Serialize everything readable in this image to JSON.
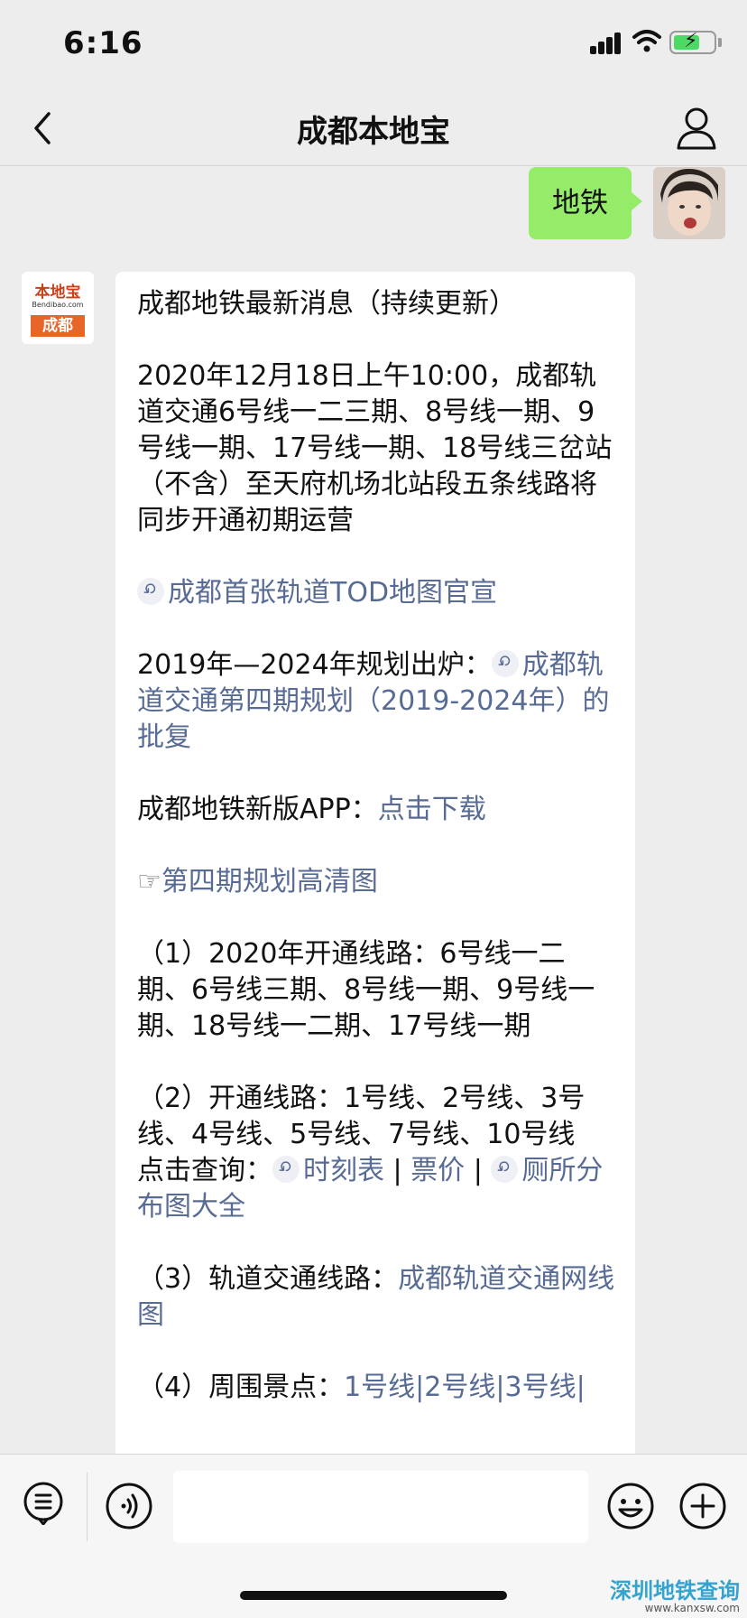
{
  "status_bar": {
    "time": "6:16"
  },
  "nav": {
    "title": "成都本地宝"
  },
  "chat": {
    "user_message": "地铁",
    "bot_avatar": {
      "logo_top": "本地宝",
      "logo_mid": "Bendibao.com",
      "logo_bottom": "成都"
    },
    "bot_message": {
      "heading": "成都地铁最新消息（持续更新）",
      "para1": "2020年12月18日上午10:00，成都轨道交通6号线一二三期、8号线一期、9号线一期、17号线一期、18号线三岔站（不含）至天府机场北站段五条线路将同步开通初期运营",
      "link_tod": "成都首张轨道TOD地图官宣",
      "plan_prefix": "2019年—2024年规划出炉：",
      "plan_link": "成都轨道交通第四期规划（2019-2024年）的批复",
      "app_prefix": "成都地铁新版APP：",
      "app_link": "点击下载",
      "hd_pointer": "☞",
      "hd_link": "第四期规划高清图",
      "item1": "（1）2020年开通线路：6号线一二期、6号线三期、8号线一期、9号线一期、18号线一二期、17号线一期",
      "item2": "（2）开通线路：1号线、2号线、3号线、4号线、5号线、7号线、10号线",
      "query_prefix": "点击查询：",
      "query_link1": "时刻表",
      "sep": " | ",
      "query_link2": "票价",
      "query_link3": "厕所分布图大全",
      "item3_prefix": "（3）轨道交通线路：",
      "item3_link": "成都轨道交通网线图",
      "item4_prefix": "（4）周围景点：",
      "item4_link": "1号线|2号线|3号线|"
    }
  },
  "input_bar": {
    "placeholder": ""
  },
  "watermark": {
    "main": "深圳地铁查询",
    "sub": "www.kanxsw.com"
  },
  "colors": {
    "background": "#ededed",
    "user_bubble": "#95ec69",
    "link": "#576b95",
    "battery_fill": "#4cd964"
  }
}
